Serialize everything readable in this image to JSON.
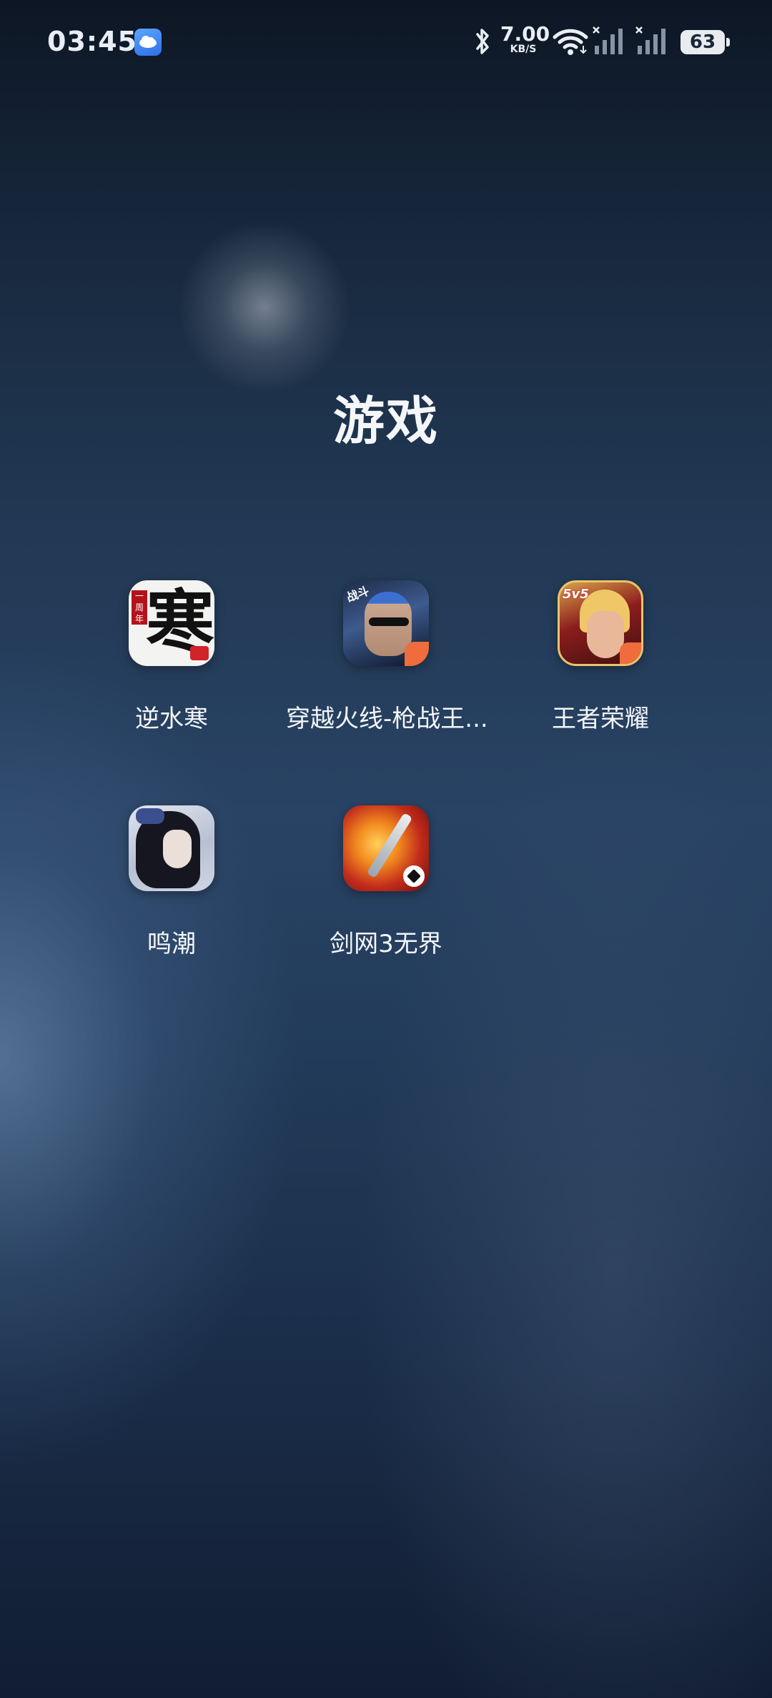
{
  "status_bar": {
    "time": "03:45",
    "net_speed_value": "7.00",
    "net_speed_unit": "KB/S",
    "battery_level": "63",
    "icons": [
      "weather-icon",
      "bluetooth-icon",
      "wifi-icon",
      "signal-icon",
      "signal-icon"
    ]
  },
  "folder": {
    "title": "游戏",
    "apps": [
      {
        "label": "逆水寒",
        "icon": "nishuihan-app-icon"
      },
      {
        "label": "穿越火线-枪战王...",
        "icon": "crossfire-app-icon"
      },
      {
        "label": "王者荣耀",
        "icon": "honor-of-kings-app-icon"
      },
      {
        "label": "鸣潮",
        "icon": "wuthering-waves-app-icon"
      },
      {
        "label": "剑网3无界",
        "icon": "jx3-app-icon"
      }
    ]
  },
  "icon_text": {
    "nishuihan_glyph": "寒",
    "nishuihan_tag": "一周年",
    "crossfire_badge": "战斗",
    "wzry_tag": "5v5"
  },
  "colors": {
    "accent_weather": "#3f86f2",
    "battery_fill": "#e8ebef"
  }
}
